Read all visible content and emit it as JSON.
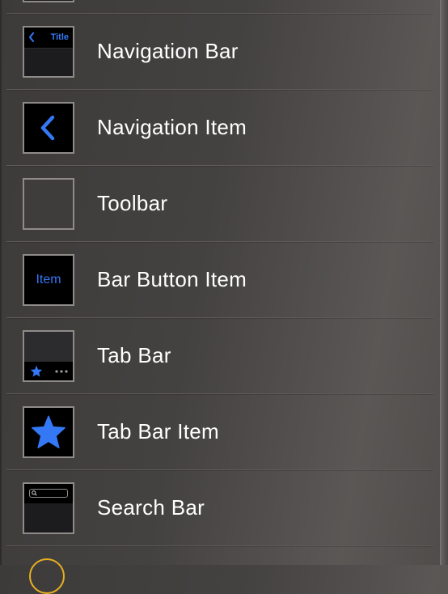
{
  "colors": {
    "accent": "#3478f6",
    "thumb_bg": "#000000",
    "label": "#ffffff"
  },
  "items": [
    {
      "label": "Navigation Bar",
      "thumb_text": "Title",
      "icon": "chevron-left-icon"
    },
    {
      "label": "Navigation Item",
      "icon": "chevron-left-icon"
    },
    {
      "label": "Toolbar"
    },
    {
      "label": "Bar Button Item",
      "thumb_text": "Item"
    },
    {
      "label": "Tab Bar",
      "icons": [
        "star-icon",
        "ellipsis-icon"
      ]
    },
    {
      "label": "Tab Bar Item",
      "icon": "star-icon"
    },
    {
      "label": "Search Bar",
      "icon": "search-icon"
    }
  ]
}
